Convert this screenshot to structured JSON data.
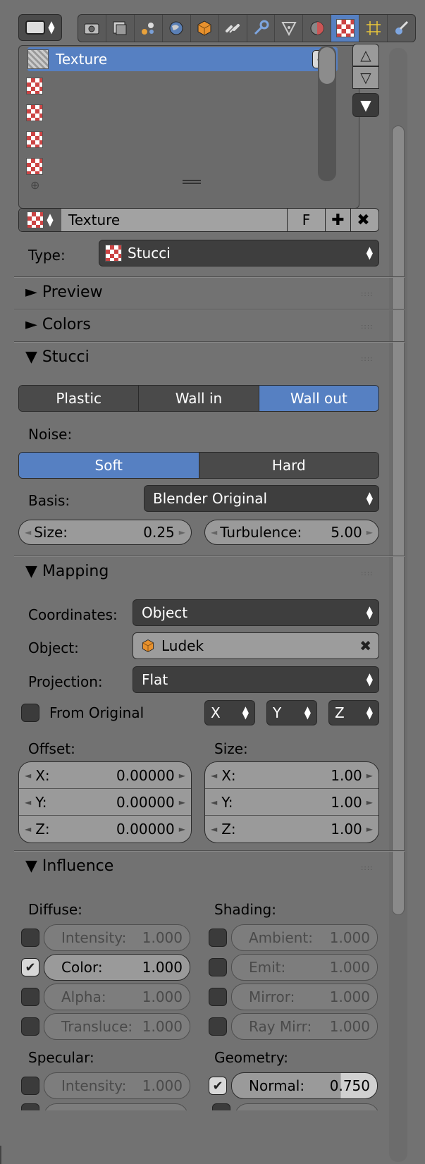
{
  "header": {
    "tabs": [
      "render-icon",
      "render-layers-icon",
      "scene-icon",
      "world-icon",
      "object-icon",
      "constraints-icon",
      "modifiers-icon",
      "data-icon",
      "material-icon",
      "texture-icon",
      "particles-icon",
      "physics-icon"
    ],
    "active_tab": "texture-icon"
  },
  "texture_list": {
    "items": [
      {
        "label": "Texture",
        "enabled": true,
        "selected": true
      },
      {
        "label": ""
      },
      {
        "label": ""
      },
      {
        "label": ""
      },
      {
        "label": ""
      }
    ]
  },
  "datablock": {
    "name": "Texture",
    "fake_user_label": "F"
  },
  "type": {
    "label": "Type:",
    "value": "Stucci"
  },
  "panels": {
    "preview": "Preview",
    "colors": "Colors",
    "stucci": "Stucci",
    "mapping": "Mapping",
    "influence": "Influence"
  },
  "stucci": {
    "modes": [
      "Plastic",
      "Wall in",
      "Wall out"
    ],
    "active_mode": "Wall out",
    "noise_label": "Noise:",
    "noise": [
      "Soft",
      "Hard"
    ],
    "active_noise": "Soft",
    "basis_label": "Basis:",
    "basis_value": "Blender Original",
    "size_label": "Size:",
    "size_value": "0.25",
    "turbulence_label": "Turbulence:",
    "turbulence_value": "5.00"
  },
  "mapping": {
    "coordinates_label": "Coordinates:",
    "coordinates_value": "Object",
    "object_label": "Object:",
    "object_value": "Ludek",
    "projection_label": "Projection:",
    "projection_value": "Flat",
    "from_original_label": "From Original",
    "axes": [
      "X",
      "Y",
      "Z"
    ],
    "offset_label": "Offset:",
    "offset": [
      {
        "axis": "X:",
        "value": "0.00000"
      },
      {
        "axis": "Y:",
        "value": "0.00000"
      },
      {
        "axis": "Z:",
        "value": "0.00000"
      }
    ],
    "size_label": "Size:",
    "size": [
      {
        "axis": "X:",
        "value": "1.00"
      },
      {
        "axis": "Y:",
        "value": "1.00"
      },
      {
        "axis": "Z:",
        "value": "1.00"
      }
    ]
  },
  "influence": {
    "diffuse_label": "Diffuse:",
    "diffuse": [
      {
        "label": "Intensity:",
        "value": "1.000",
        "checked": false
      },
      {
        "label": "Color:",
        "value": "1.000",
        "checked": true
      },
      {
        "label": "Alpha:",
        "value": "1.000",
        "checked": false
      },
      {
        "label": "Transluce:",
        "value": "1.000",
        "checked": false
      }
    ],
    "shading_label": "Shading:",
    "shading": [
      {
        "label": "Ambient:",
        "value": "1.000",
        "checked": false
      },
      {
        "label": "Emit:",
        "value": "1.000",
        "checked": false
      },
      {
        "label": "Mirror:",
        "value": "1.000",
        "checked": false
      },
      {
        "label": "Ray Mirr:",
        "value": "1.000",
        "checked": false
      }
    ],
    "specular_label": "Specular:",
    "specular": [
      {
        "label": "Intensity:",
        "value": "1.000",
        "checked": false
      }
    ],
    "geometry_label": "Geometry:",
    "geometry": [
      {
        "label": "Normal:",
        "value": "0.750",
        "checked": true
      }
    ]
  }
}
